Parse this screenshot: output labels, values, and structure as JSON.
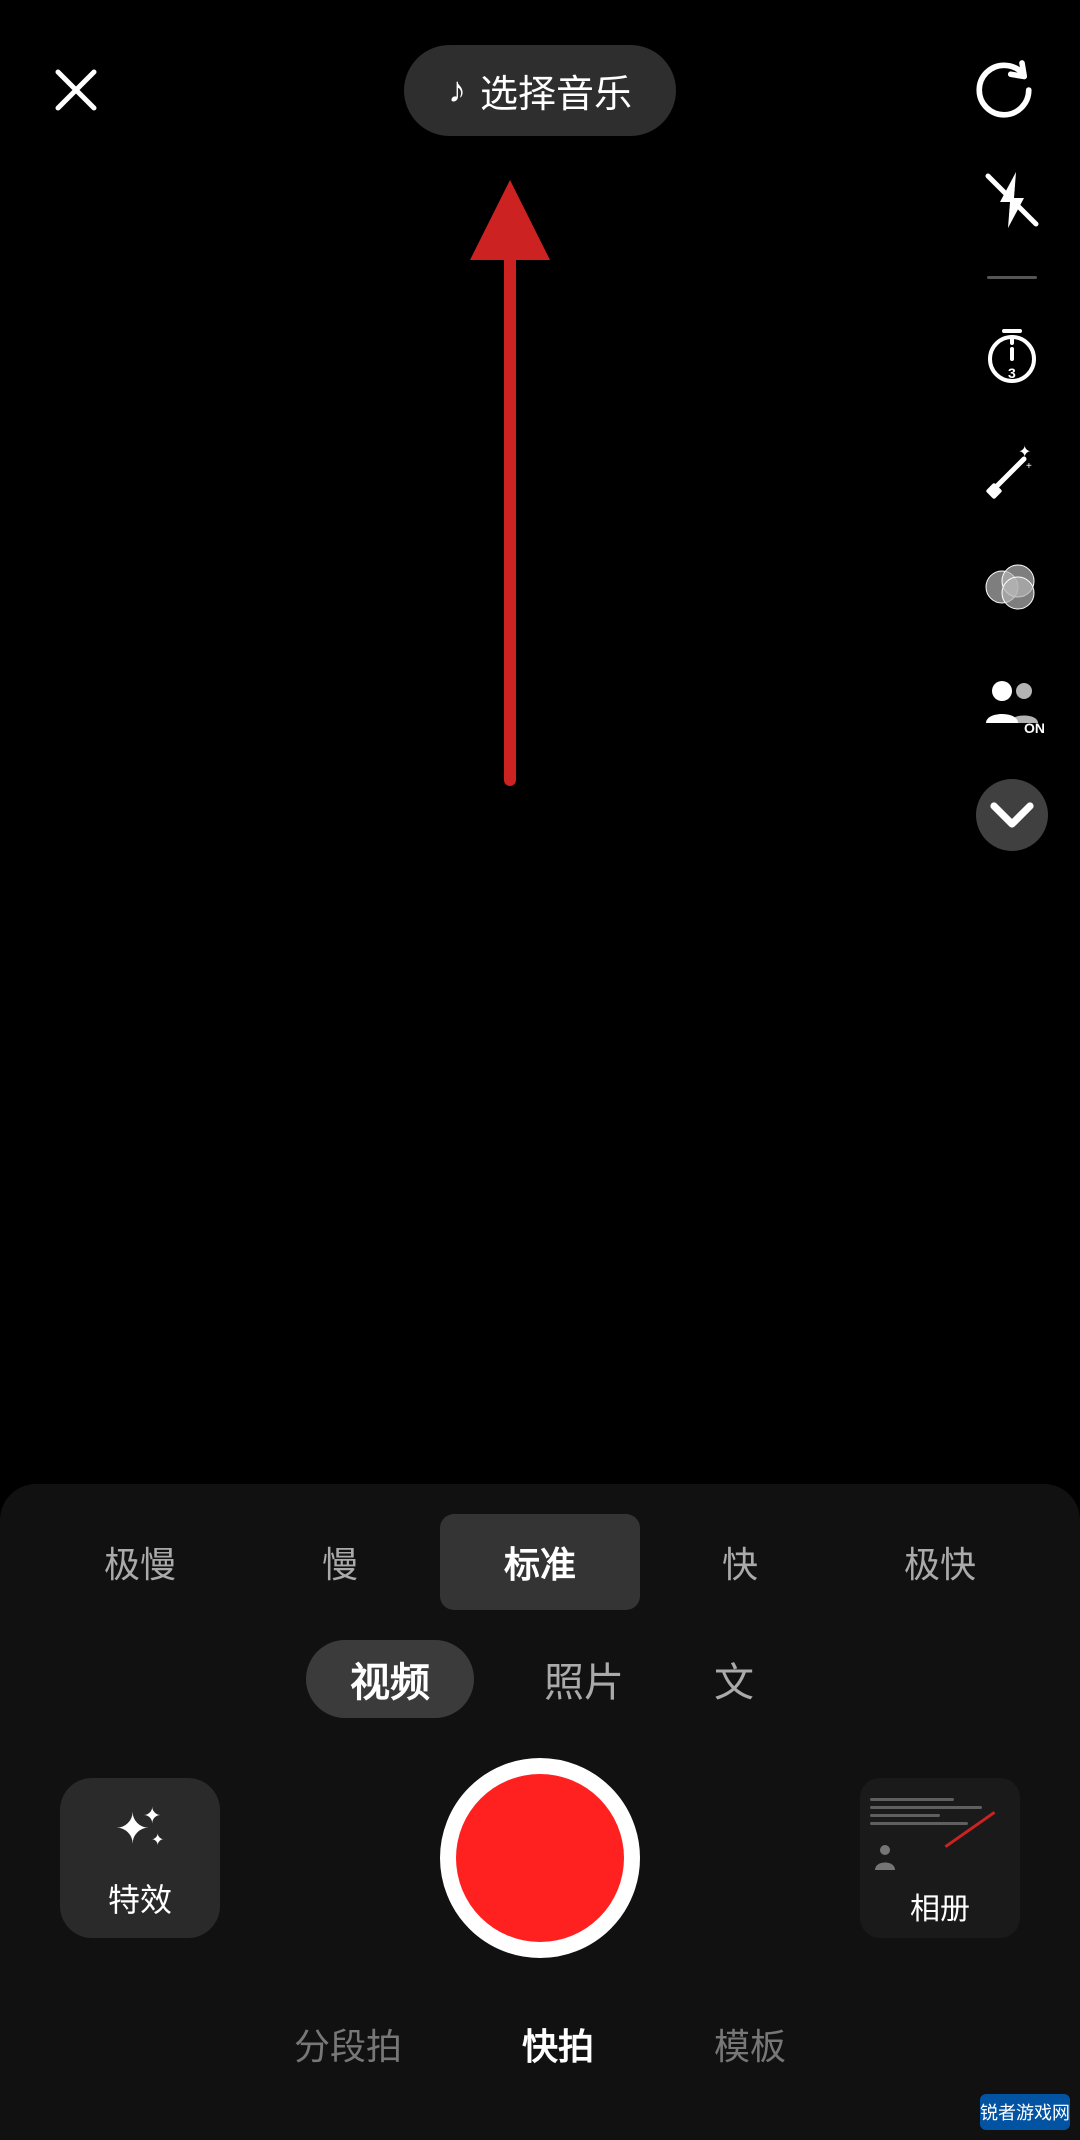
{
  "header": {
    "close_label": "×",
    "music_note": "♪",
    "music_label": "选择音乐",
    "refresh_label": "↻"
  },
  "sidebar": {
    "icons": [
      {
        "name": "flash-off-icon",
        "label": "闪光灯关"
      },
      {
        "name": "divider",
        "label": ""
      },
      {
        "name": "timer-icon",
        "label": "定时器"
      },
      {
        "name": "beauty-icon",
        "label": "美颜"
      },
      {
        "name": "filter-icon",
        "label": "滤镜"
      },
      {
        "name": "duet-icon",
        "label": "合拍"
      },
      {
        "name": "expand-icon",
        "label": "展开"
      }
    ]
  },
  "speed_tabs": {
    "items": [
      {
        "label": "极慢",
        "active": false
      },
      {
        "label": "慢",
        "active": false
      },
      {
        "label": "标准",
        "active": true
      },
      {
        "label": "快",
        "active": false
      },
      {
        "label": "极快",
        "active": false
      }
    ]
  },
  "mode_tabs": {
    "items": [
      {
        "label": "视频",
        "active": true
      },
      {
        "label": "照片",
        "active": false
      },
      {
        "label": "文",
        "active": false
      }
    ]
  },
  "capture": {
    "effects_label": "特效",
    "album_label": "相册"
  },
  "bottom_nav": {
    "items": [
      {
        "label": "分段拍",
        "active": false
      },
      {
        "label": "快拍",
        "active": true
      },
      {
        "label": "模板",
        "active": false
      }
    ]
  },
  "watermark": {
    "text": "锐者游戏网"
  }
}
